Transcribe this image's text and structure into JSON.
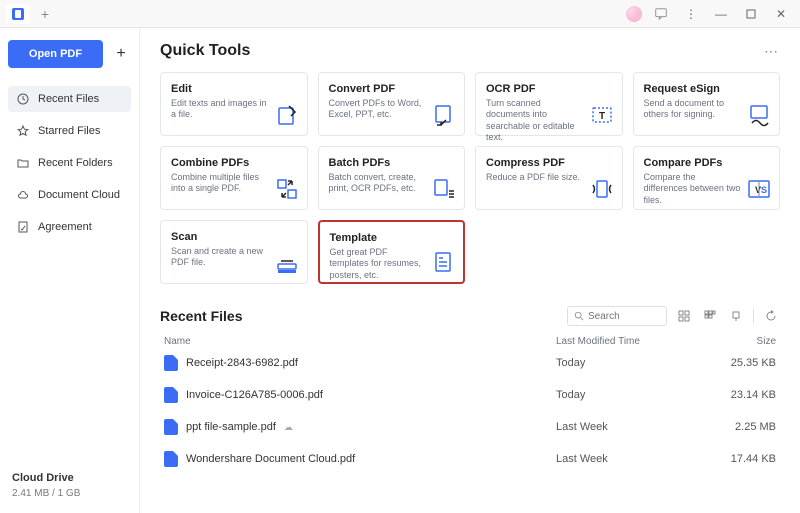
{
  "titlebar": {
    "new_tab_tooltip": "+"
  },
  "sidebar": {
    "open_label": "Open PDF",
    "items": [
      {
        "label": "Recent Files",
        "icon": "clock-icon",
        "active": true
      },
      {
        "label": "Starred Files",
        "icon": "star-icon"
      },
      {
        "label": "Recent Folders",
        "icon": "folder-icon"
      },
      {
        "label": "Document Cloud",
        "icon": "cloud-icon"
      },
      {
        "label": "Agreement",
        "icon": "agreement-icon"
      }
    ],
    "cloud_drive_label": "Cloud Drive",
    "cloud_drive_quota": "2.41 MB / 1 GB"
  },
  "quick_tools": {
    "heading": "Quick Tools",
    "cards": [
      {
        "title": "Edit",
        "desc": "Edit texts and images in a file."
      },
      {
        "title": "Convert PDF",
        "desc": "Convert PDFs to Word, Excel, PPT, etc."
      },
      {
        "title": "OCR PDF",
        "desc": "Turn scanned documents into searchable or editable text."
      },
      {
        "title": "Request eSign",
        "desc": "Send a document to others for signing."
      },
      {
        "title": "Combine PDFs",
        "desc": "Combine multiple files into a single PDF."
      },
      {
        "title": "Batch PDFs",
        "desc": "Batch convert, create, print, OCR PDFs, etc."
      },
      {
        "title": "Compress PDF",
        "desc": "Reduce a PDF file size."
      },
      {
        "title": "Compare PDFs",
        "desc": "Compare the differences between two files."
      },
      {
        "title": "Scan",
        "desc": "Scan and create a new PDF file."
      },
      {
        "title": "Template",
        "desc": "Get great PDF templates for resumes, posters, etc.",
        "highlight": true
      }
    ]
  },
  "recent_files": {
    "heading": "Recent Files",
    "search_placeholder": "Search",
    "columns": {
      "name": "Name",
      "modified": "Last Modified Time",
      "size": "Size"
    },
    "rows": [
      {
        "name": "Receipt-2843-6982.pdf",
        "modified": "Today",
        "size": "25.35 KB"
      },
      {
        "name": "Invoice-C126A785-0006.pdf",
        "modified": "Today",
        "size": "23.14 KB"
      },
      {
        "name": "ppt file-sample.pdf",
        "modified": "Last Week",
        "size": "2.25 MB",
        "cloud": true
      },
      {
        "name": "Wondershare Document Cloud.pdf",
        "modified": "Last Week",
        "size": "17.44 KB"
      }
    ]
  }
}
